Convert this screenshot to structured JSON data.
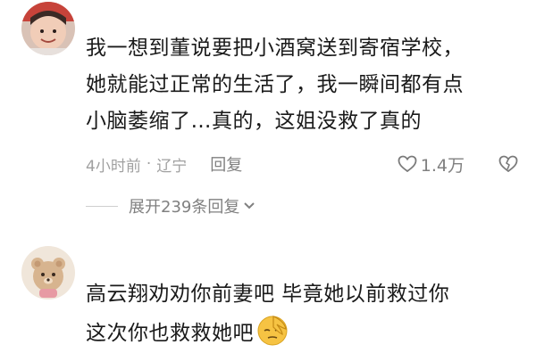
{
  "comments": [
    {
      "text": "我一想到董说要把小酒窝送到寄宿学校，\n她就能过正常的生活了，我一瞬间都有点\n小脑萎缩了…真的，这姐没救了真的",
      "time": "4小时前",
      "location": "辽宁",
      "reply_label": "回复",
      "likes": "1.4万",
      "expand_label": "展开239条回复"
    },
    {
      "text": "高云翔劝劝你前妻吧 毕竟她以前救过你\n这次你也救救她吧",
      "emoji": "facepalm-emoji"
    }
  ],
  "colors": {
    "meta_gray": "#a0a0a0",
    "text": "#1a1a1a",
    "avatar1_bg": "#e8b8a8",
    "avatar2_bg": "#efe3d4"
  }
}
